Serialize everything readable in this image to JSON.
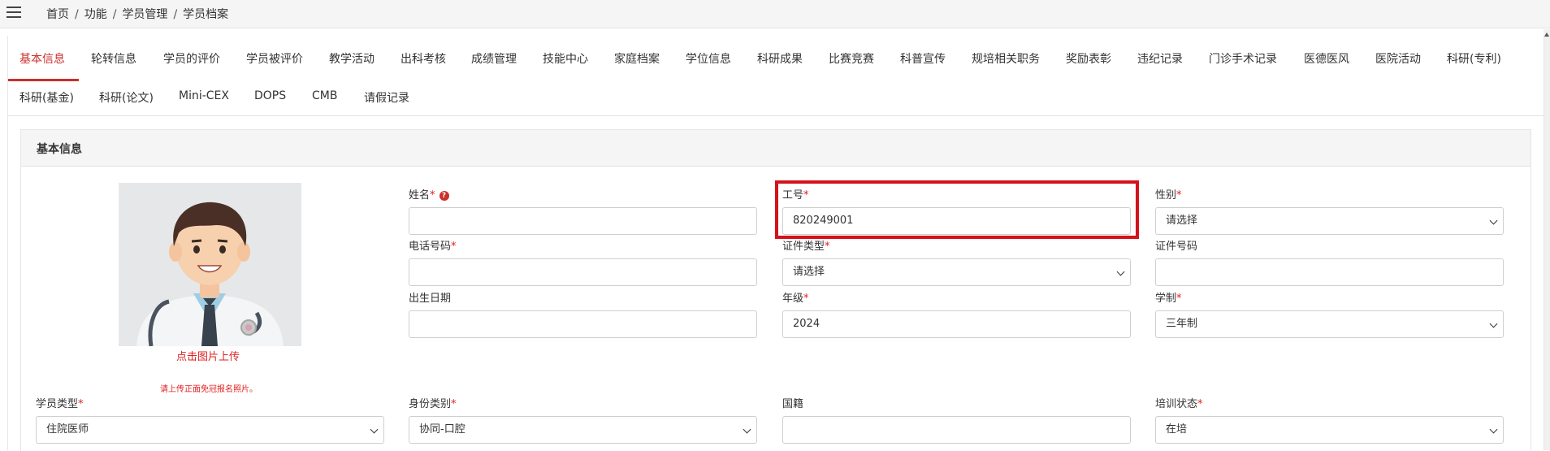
{
  "breadcrumb": [
    "首页",
    "功能",
    "学员管理",
    "学员档案"
  ],
  "tabs_row1": [
    "基本信息",
    "轮转信息",
    "学员的评价",
    "学员被评价",
    "教学活动",
    "出科考核",
    "成绩管理",
    "技能中心",
    "家庭档案",
    "学位信息",
    "科研成果",
    "比赛竞赛",
    "科普宣传",
    "规培相关职务",
    "奖励表彰",
    "违纪记录",
    "门诊手术记录",
    "医德医风",
    "医院活动",
    "科研(专利)"
  ],
  "tabs_row2": [
    "科研(基金)",
    "科研(论文)",
    "Mini-CEX",
    "DOPS",
    "CMB",
    "请假记录"
  ],
  "panel": {
    "title": "基本信息"
  },
  "avatar": {
    "upload_label": "点击图片上传",
    "hint": "请上传正面免冠报名照片。"
  },
  "form": {
    "name": {
      "label": "姓名",
      "value": ""
    },
    "emp_no": {
      "label": "工号",
      "value": "820249001"
    },
    "gender": {
      "label": "性别",
      "value": "请选择"
    },
    "phone": {
      "label": "电话号码",
      "value": ""
    },
    "id_type": {
      "label": "证件类型",
      "value": "请选择"
    },
    "id_no": {
      "label": "证件号码",
      "value": ""
    },
    "birth": {
      "label": "出生日期",
      "value": ""
    },
    "grade": {
      "label": "年级",
      "value": "2024"
    },
    "duration": {
      "label": "学制",
      "value": "三年制"
    },
    "student_type": {
      "label": "学员类型",
      "value": "住院医师"
    },
    "identity": {
      "label": "身份类别",
      "value": "协同-口腔"
    },
    "nationality": {
      "label": "国籍",
      "value": ""
    },
    "train_status": {
      "label": "培训状态",
      "value": "在培"
    }
  },
  "required_mark": "*",
  "help_mark": "?",
  "colors": {
    "accent": "#c9302c",
    "required": "#e02020",
    "highlight": "#d4121a"
  }
}
